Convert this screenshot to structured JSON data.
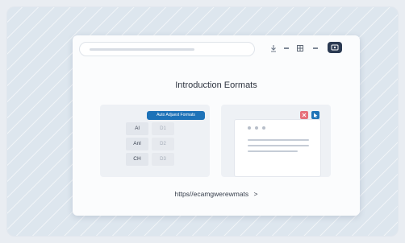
{
  "window": {
    "title": "Introduction Eormats",
    "link_text": "https//ecamgwerewmats",
    "link_chevron": ">"
  },
  "toolbar": {
    "icons": [
      "download-icon",
      "dash-icon",
      "grid-icon",
      "dash-icon",
      "cast-icon"
    ]
  },
  "left_panel": {
    "button_label": "Auto Adjuest Formats",
    "rows": [
      {
        "label": "Al",
        "value": "D1"
      },
      {
        "label": "Anl",
        "value": "D2"
      },
      {
        "label": "CH",
        "value": "D3"
      }
    ]
  },
  "right_panel": {
    "icons": [
      "close-icon",
      "cursor-icon"
    ]
  },
  "colors": {
    "accent_blue": "#1d72b8",
    "accent_red": "#e66f7a",
    "dark_button": "#2b3a52"
  }
}
